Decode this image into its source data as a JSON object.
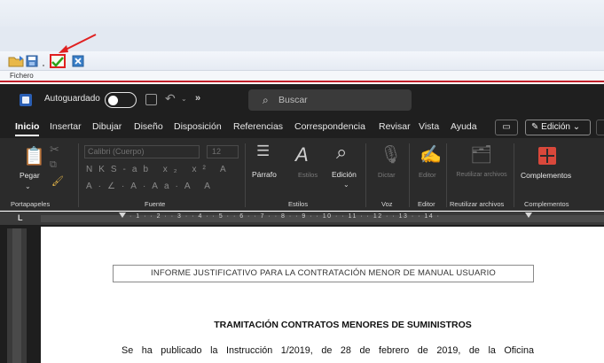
{
  "host": {
    "menu_label": "Fichero",
    "toolbar": [
      "open-icon",
      "save-icon",
      "check-icon",
      "close-icon"
    ],
    "highlight_color": "#e02020"
  },
  "titlebar": {
    "autosave_label": "Autoguardado",
    "autosave_state": "",
    "more_label": "»",
    "search_placeholder": "Buscar"
  },
  "ribbon_tabs": [
    {
      "label": "Inicio",
      "active": true
    },
    {
      "label": "Insertar"
    },
    {
      "label": "Dibujar"
    },
    {
      "label": "Diseño"
    },
    {
      "label": "Disposición"
    },
    {
      "label": "Referencias"
    },
    {
      "label": "Correspondencia"
    },
    {
      "label": "Revisar"
    },
    {
      "label": "Vista"
    },
    {
      "label": "Ayuda"
    }
  ],
  "edit_mode_label": "Edición",
  "ribbon": {
    "paste_label": "Pegar",
    "font_name": "Calibri (Cuerpo)",
    "font_size": "12",
    "paragraph_label": "Párrafo",
    "styles_label": "Estilos",
    "editing_label": "Edición",
    "dictate_label": "Dictar",
    "editor_label": "Editor",
    "reuse_label": "Reutilizar archivos",
    "addins_label": "Complementos",
    "groups": {
      "clipboard": "Portapapeles",
      "font": "Fuente",
      "styles": "Estilos",
      "voice": "Voz",
      "editor": "Editor",
      "reuse": "Reutilizar archivos",
      "addins": "Complementos"
    }
  },
  "ruler": {
    "corner": "L",
    "marks": "· 1 · · 2 · · 3 · · 4 · · 5 · · 6 · · 7 · · 8 · · 9 · · 10 · · 11 · · 12 · · 13 · · 14 ·"
  },
  "document": {
    "header_box": "INFORME JUSTIFICATIVO PARA LA CONTRATACIÓN MENOR DE MANUAL USUARIO",
    "title": "TRAMITACIÓN CONTRATOS MENORES DE SUMINISTROS",
    "body_line": "Se ha publicado la Instrucción 1/2019, de 28 de febrero de 2019, de la Oficina"
  },
  "colors": {
    "title_bar": "#1f1f1f",
    "ribbon": "#2b2b2b",
    "accent_red": "#e02020",
    "addins_icon": "#d9483b"
  }
}
